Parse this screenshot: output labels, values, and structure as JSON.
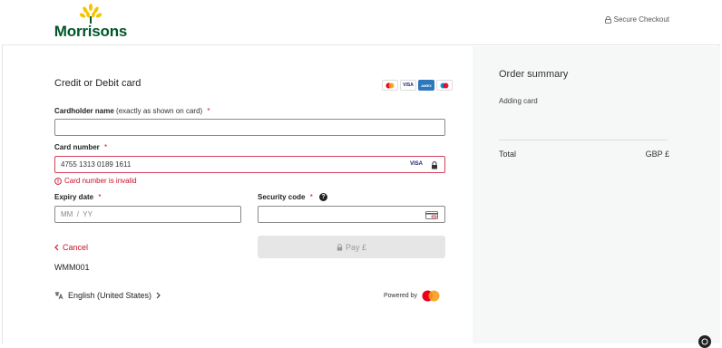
{
  "header": {
    "brand": "Morrisons",
    "secure_checkout": "Secure Checkout"
  },
  "form": {
    "title": "Credit or Debit card",
    "card_logos": [
      {
        "name": "mastercard",
        "label": ""
      },
      {
        "name": "visa",
        "label": "VISA"
      },
      {
        "name": "amex",
        "label": "AMEX"
      },
      {
        "name": "maestro",
        "label": ""
      }
    ],
    "cardholder": {
      "label": "Cardholder name",
      "sublabel": "(exactly as shown on card)",
      "required_mark": "*",
      "value": ""
    },
    "card_number": {
      "label": "Card number",
      "required_mark": "*",
      "value": "4755 1313 0189 1611",
      "brand_badge": "VISA",
      "error": "Card number is invalid"
    },
    "expiry": {
      "label": "Expiry date",
      "required_mark": "*",
      "placeholder": "MM  /  YY"
    },
    "security": {
      "label": "Security code",
      "required_mark": "*",
      "value": ""
    },
    "cancel_label": "Cancel",
    "pay_label": "Pay £",
    "reference": "WMM001",
    "language": "English (United States)",
    "powered_by": "Powered by"
  },
  "summary": {
    "title": "Order summary",
    "item": "Adding card",
    "total_label": "Total",
    "total_currency": "GBP £"
  },
  "colors": {
    "brand_green": "#00562a",
    "brand_yellow": "#f5c400",
    "error_red": "#c8102e",
    "panel_bg": "#f6f7f7"
  }
}
